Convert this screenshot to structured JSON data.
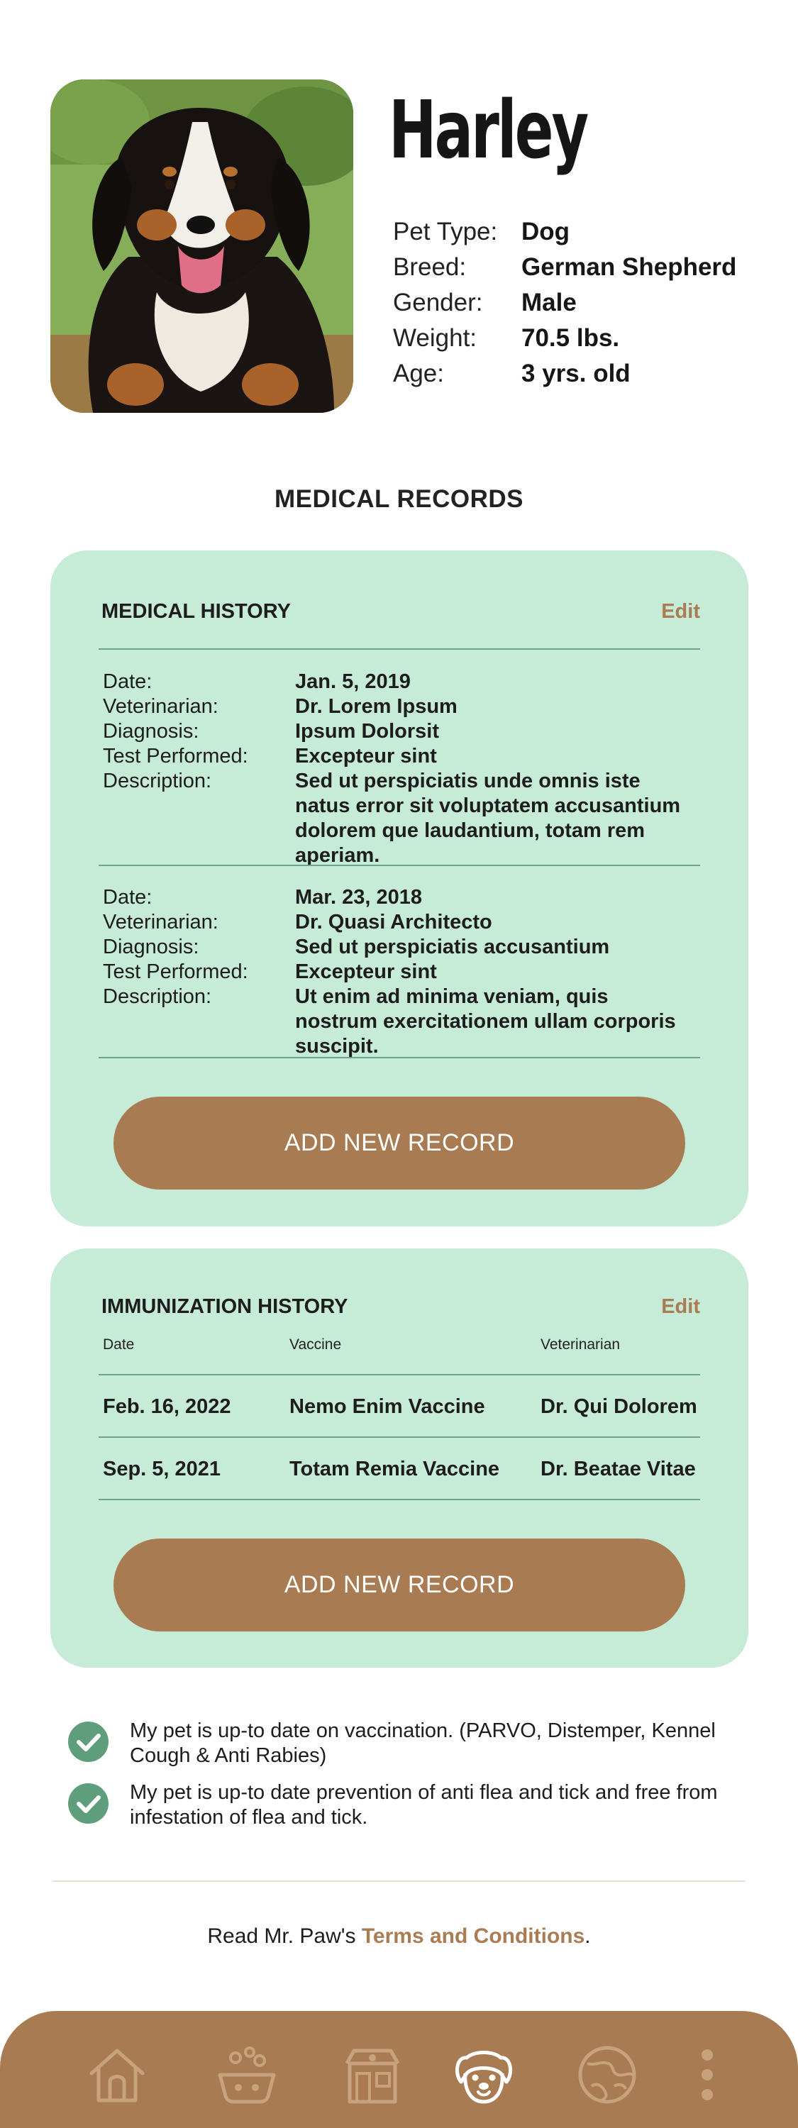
{
  "pet": {
    "name": "Harley",
    "details": [
      {
        "label": "Pet Type:",
        "value": "Dog"
      },
      {
        "label": "Breed:",
        "value": "German Shepherd"
      },
      {
        "label": "Gender:",
        "value": "Male"
      },
      {
        "label": "Weight:",
        "value": "70.5 lbs."
      },
      {
        "label": "Age:",
        "value": "3 yrs. old"
      }
    ]
  },
  "section_title": "MEDICAL RECORDS",
  "medical_history": {
    "title": "MEDICAL HISTORY",
    "edit_label": "Edit",
    "field_labels": {
      "date": "Date:",
      "veterinarian": "Veterinarian:",
      "diagnosis": "Diagnosis:",
      "test": "Test Performed:",
      "description": "Description:"
    },
    "records": [
      {
        "date": "Jan. 5, 2019",
        "veterinarian": "Dr. Lorem Ipsum",
        "diagnosis": "Ipsum Dolorsit",
        "test": "Excepteur sint",
        "description": "Sed ut perspiciatis unde omnis iste natus error sit voluptatem accusantium dolorem que laudantium, totam rem aperiam."
      },
      {
        "date": "Mar. 23, 2018",
        "veterinarian": "Dr. Quasi Architecto",
        "diagnosis": "Sed ut perspiciatis accusantium",
        "test": "Excepteur sint",
        "description": "Ut enim ad minima veniam, quis nostrum exercitationem ullam corporis suscipit."
      }
    ],
    "add_button": "ADD NEW RECORD"
  },
  "immunization_history": {
    "title": "IMMUNIZATION HISTORY",
    "edit_label": "Edit",
    "columns": {
      "date": "Date",
      "vaccine": "Vaccine",
      "veterinarian": "Veterinarian"
    },
    "rows": [
      {
        "date": "Feb. 16, 2022",
        "vaccine": "Nemo Enim Vaccine",
        "veterinarian": "Dr. Qui Dolorem"
      },
      {
        "date": "Sep. 5, 2021",
        "vaccine": "Totam Remia Vaccine",
        "veterinarian": "Dr. Beatae Vitae"
      }
    ],
    "add_button": "ADD NEW RECORD"
  },
  "checks": [
    "My pet is up-to date on vaccination. (PARVO, Distemper, Kennel Cough & Anti Rabies)",
    "My pet is up-to date prevention of anti flea and tick and free from infestation of flea and tick."
  ],
  "terms": {
    "prefix": "Read Mr. Paw's ",
    "link": "Terms and Conditions",
    "suffix": "."
  },
  "colors": {
    "card_bg": "#c6ebd7",
    "accent_brown": "#a97b53",
    "check_green": "#5e9e7c",
    "divider_green": "#6ea386"
  },
  "nav": {
    "items": [
      {
        "icon": "home-icon",
        "active": false
      },
      {
        "icon": "pet-bath-icon",
        "active": false
      },
      {
        "icon": "pet-shop-icon",
        "active": false
      },
      {
        "icon": "dog-face-icon",
        "active": true
      },
      {
        "icon": "pet-globe-icon",
        "active": false
      },
      {
        "icon": "more-vertical-icon",
        "active": false
      }
    ]
  }
}
